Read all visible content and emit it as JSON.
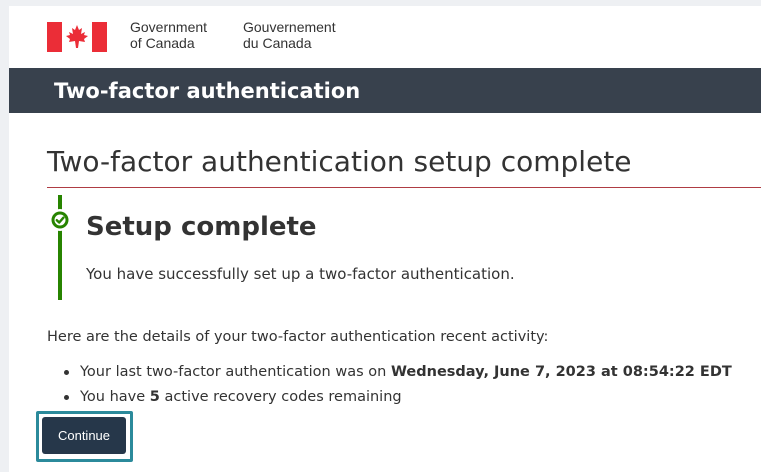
{
  "header": {
    "signature_en_line1": "Government",
    "signature_en_line2": "of Canada",
    "signature_fr_line1": "Gouvernement",
    "signature_fr_line2": "du Canada",
    "flag_icon": "canada-flag-icon",
    "flag_color": "#eb2d37"
  },
  "app_bar": {
    "title": "Two-factor authentication",
    "background": "#38414d"
  },
  "main": {
    "page_title": "Two-factor authentication setup complete",
    "alert": {
      "icon": "check-circle-icon",
      "color": "#278400",
      "heading": "Setup complete",
      "text": "You have successfully set up a two-factor authentication."
    },
    "details_intro": "Here are the details of your two-factor authentication recent activity:",
    "details": {
      "item1_prefix": "Your last two-factor authentication was on",
      "item1_date": "Wednesday, June 7, 2023 at 08:54:22 EDT",
      "item2_prefix": "You have",
      "item2_count": "5",
      "item2_suffix": "active recovery codes remaining"
    },
    "continue_label": "Continue",
    "button_color": "#26374a",
    "focus_color": "#2b8a9b"
  }
}
